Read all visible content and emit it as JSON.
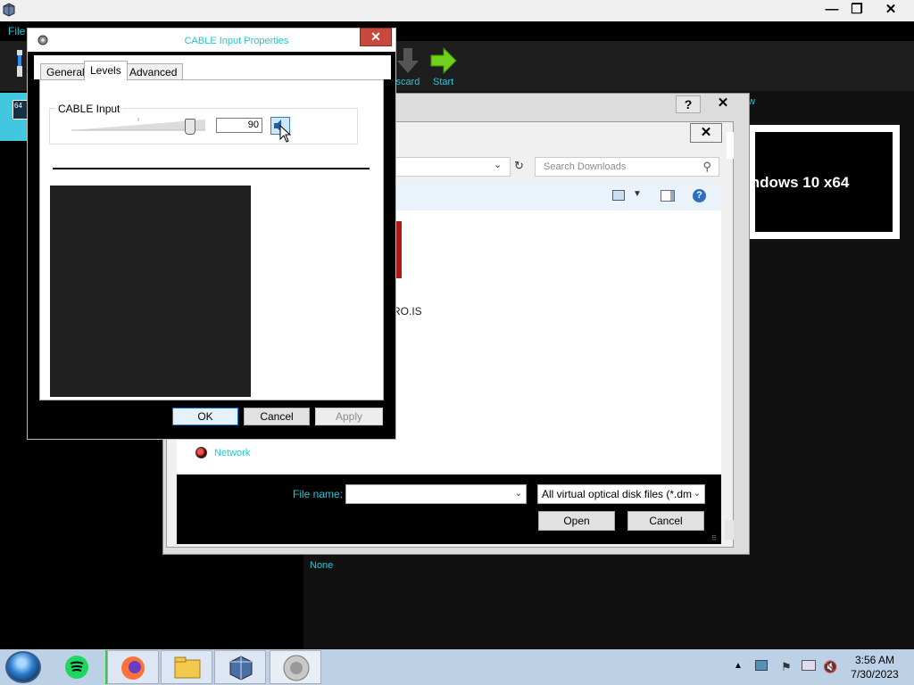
{
  "virtualbox": {
    "menu_file": "File",
    "window_controls": {
      "minimize": "—",
      "restore": "❐",
      "close": "✕"
    },
    "toolbar": {
      "discard_label": "iscard",
      "start_label": "Start"
    },
    "vm_badge": "64",
    "preview": {
      "label": "indows 10 x64",
      "corner_text": "w"
    },
    "none_label": "None"
  },
  "open_dialog": {
    "help_label": "?",
    "close_label": "✕",
    "inner_close_label": "✕",
    "search_placeholder": "Search Downloads",
    "file_label": "RO.IS",
    "nav_network": "Network",
    "filename_label": "File name:",
    "filename_value": "",
    "filter_value": "All virtual optical disk files (*.dm",
    "open_button": "Open",
    "cancel_button": "Cancel"
  },
  "cable_properties": {
    "title": "CABLE Input Properties",
    "close_label": "✕",
    "tabs": [
      {
        "label": "General"
      },
      {
        "label": "Levels"
      },
      {
        "label": "Advanced"
      }
    ],
    "active_tab": "Levels",
    "level_group_label": "CABLE Input",
    "level_value": "90",
    "level_fraction": 0.9,
    "ok_button": "OK",
    "cancel_button": "Cancel",
    "apply_button": "Apply"
  },
  "taskbar": {
    "pinned": [
      "start-orb",
      "spotify-icon",
      "firefox-icon",
      "file-explorer-icon",
      "virtualbox-icon",
      "speaker-icon"
    ],
    "clock_time": "3:56 AM",
    "clock_date": "7/30/2023"
  },
  "colors": {
    "accent_cyan": "#1ec8d8",
    "close_red": "#c9483e",
    "taskbar": "#bcd0e6"
  }
}
